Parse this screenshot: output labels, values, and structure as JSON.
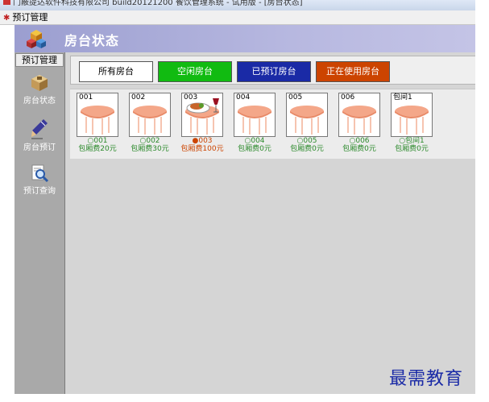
{
  "window": {
    "title": "门蔽提达软件科技有限公司  build20121200 餐饮管理系统 - 试用版 - [房台状态]"
  },
  "menu": {
    "items": [
      {
        "label": "预订管理"
      }
    ]
  },
  "banner": {
    "title": "房台状态"
  },
  "sidebar": {
    "header": "预订管理",
    "items": [
      {
        "label": "房台状态",
        "icon": "box-icon"
      },
      {
        "label": "房台预订",
        "icon": "pen-icon"
      },
      {
        "label": "预订查询",
        "icon": "magnifier-icon"
      }
    ]
  },
  "filters": [
    {
      "label": "所有房台",
      "bg": "#ffffff",
      "fg": "#000000"
    },
    {
      "label": "空闲房台",
      "bg": "#11bb11",
      "fg": "#ffffff"
    },
    {
      "label": "已预订房台",
      "bg": "#1a2aa6",
      "fg": "#ffffff"
    },
    {
      "label": "正在使用房台",
      "bg": "#cc4400",
      "fg": "#ffffff"
    }
  ],
  "rooms": [
    {
      "code": "001",
      "status_line": "○001",
      "fee_line": "包厢费20元",
      "status": "free"
    },
    {
      "code": "002",
      "status_line": "○002",
      "fee_line": "包厢费30元",
      "status": "free"
    },
    {
      "code": "003",
      "status_line": "●003",
      "fee_line": "包厢费100元",
      "status": "in-use"
    },
    {
      "code": "004",
      "status_line": "○004",
      "fee_line": "包厢费0元",
      "status": "free"
    },
    {
      "code": "005",
      "status_line": "○005",
      "fee_line": "包厢费0元",
      "status": "free"
    },
    {
      "code": "006",
      "status_line": "○006",
      "fee_line": "包厢费0元",
      "status": "free"
    },
    {
      "code": "包间1",
      "status_line": "○包间1",
      "fee_line": "包厢费0元",
      "status": "free"
    }
  ],
  "watermark": "最需教育",
  "colors": {
    "banner": "#a7a9d8",
    "sidebar": "#a9a9a9",
    "workspace": "#d5d5d5",
    "free_text": "#2c8a2c",
    "in_use_text": "#cc4400"
  }
}
